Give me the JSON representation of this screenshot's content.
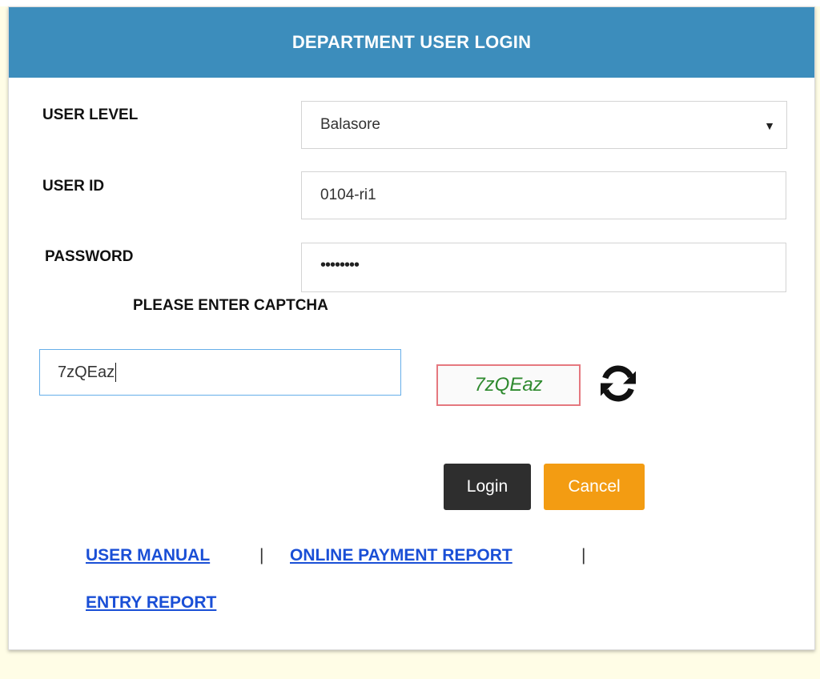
{
  "header": {
    "title": "DEPARTMENT USER LOGIN"
  },
  "form": {
    "user_level": {
      "label": "USER LEVEL",
      "selected": "Balasore"
    },
    "user_id": {
      "label": "USER ID",
      "value": "0104-ri1"
    },
    "password": {
      "label": "PASSWORD",
      "masked_value": "••••••••"
    },
    "captcha": {
      "label": "PLEASE ENTER CAPTCHA",
      "input_value": "7zQEaz",
      "image_text": "7zQEaz"
    }
  },
  "buttons": {
    "login_label": "Login",
    "cancel_label": "Cancel"
  },
  "links": {
    "user_manual": "USER MANUAL",
    "separator": "|",
    "online_payment_report": "ONLINE PAYMENT REPORT",
    "entry_report": "ENTRY REPORT"
  },
  "colors": {
    "header_bg": "#3c8dbc",
    "login_bg": "#2e2e2e",
    "cancel_bg": "#f39c12",
    "link": "#1a4fd6",
    "captcha_text": "#2f8a2f",
    "captcha_border": "#e5787f",
    "page_bg": "#fffde6"
  },
  "icons": {
    "refresh": "refresh-icon",
    "select_arrow": "caret-down-icon"
  }
}
